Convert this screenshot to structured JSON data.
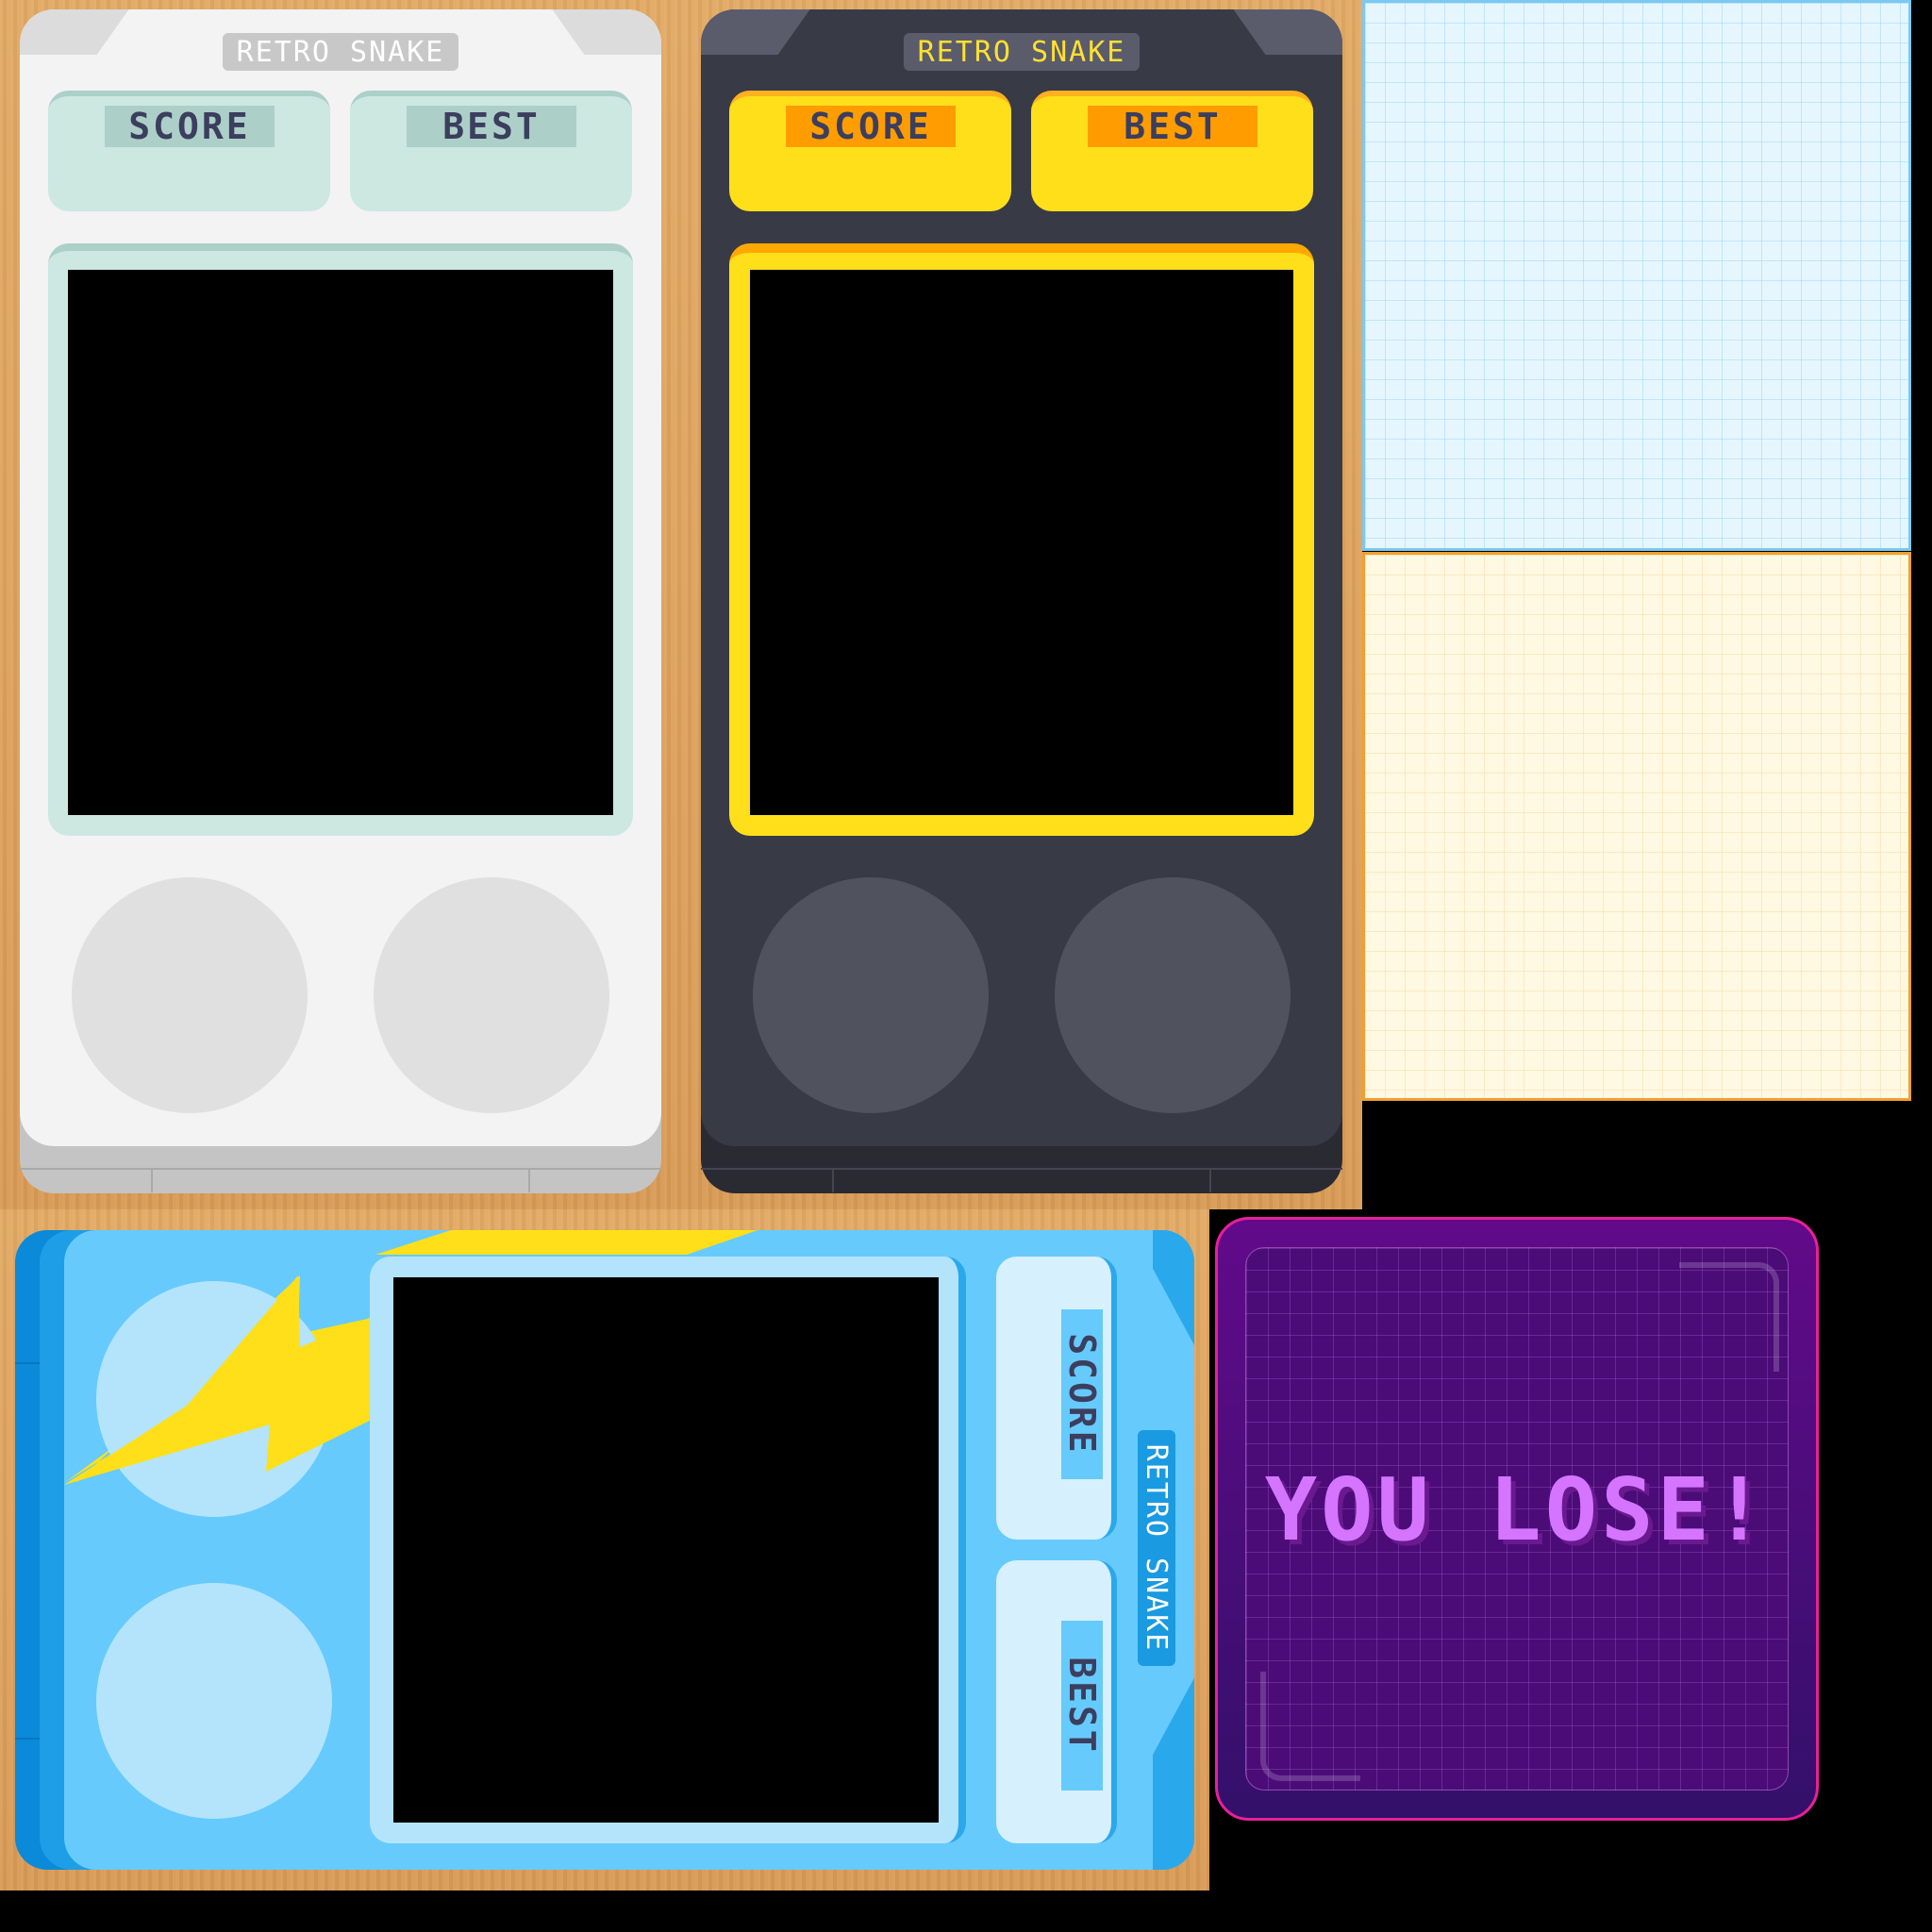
{
  "sprites": {
    "light_console": {
      "title": "RETRO SNAKE",
      "score_label": "SCORE",
      "best_label": "BEST",
      "accent": "#cde7e1"
    },
    "dark_console": {
      "title": "RETRO SNAKE",
      "score_label": "SCORE",
      "best_label": "BEST",
      "accent": "#ffdf1a"
    },
    "blue_console": {
      "title": "RETRO SNAKE",
      "score_label": "SCORE",
      "best_label": "BEST",
      "accent": "#66cafd"
    },
    "blue_grid_panel": {
      "accent": "#7cc8f0"
    },
    "yellow_grid_panel": {
      "accent": "#f0a030"
    },
    "lose_panel": {
      "message": "YOU LOSE!",
      "accent": "#d575ff"
    }
  },
  "colors": {
    "wood": "#dea25e",
    "background": "#000000",
    "label_text": "#3c3e5e"
  }
}
